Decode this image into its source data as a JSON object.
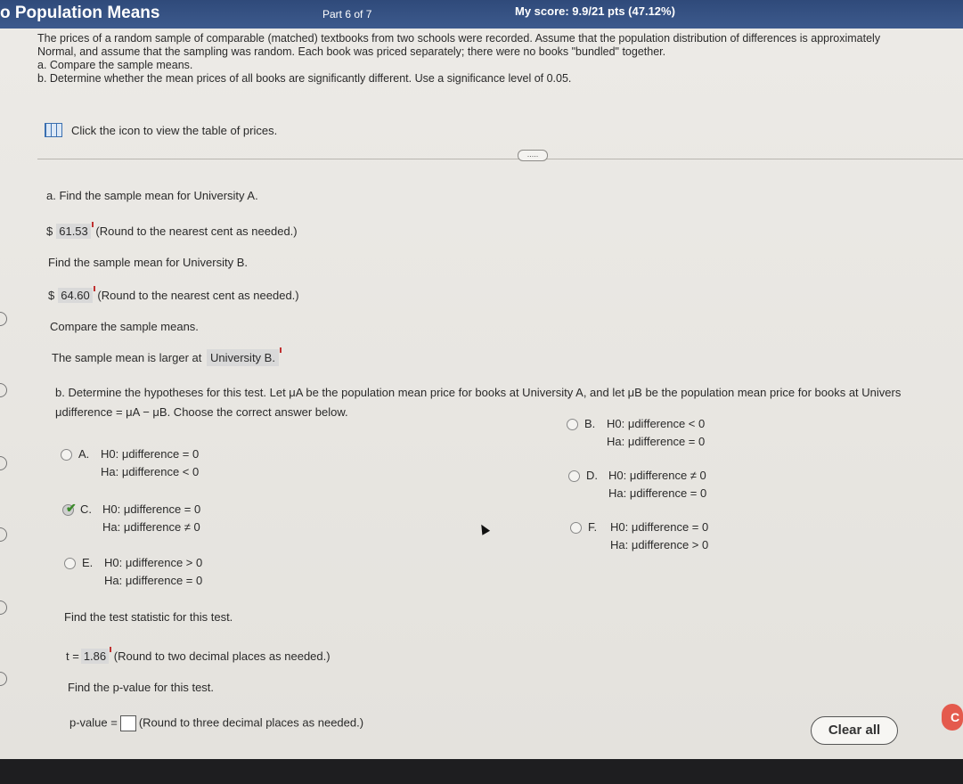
{
  "header": {
    "title": "o Population Means",
    "part": "Part 6 of 7",
    "score": "My score: 9.9/21 pts (47.12%)"
  },
  "intro": {
    "text": "The prices of a random sample of comparable (matched) textbooks from two schools were recorded. Assume that the population distribution of differences is approximately Normal, and assume that the sampling was random. Each book was priced separately; there were no books \"bundled\" together.",
    "a": "a. Compare the sample means.",
    "b": "b. Determine whether the mean prices of all books are significantly different. Use a significance level of 0.05.",
    "table_link": "Click the icon to view the table of prices."
  },
  "part_a": {
    "q1": "a. Find the sample mean for University A.",
    "a1_prefix": "$",
    "a1_value": "61.53",
    "a1_hint": "(Round to the nearest cent as needed.)",
    "q2": "Find the sample mean for University B.",
    "a2_prefix": "$",
    "a2_value": "64.60",
    "a2_hint": "(Round to the nearest cent as needed.)",
    "q3": "Compare the sample means.",
    "a3_prefix": "The sample mean is larger at",
    "a3_value": "University B."
  },
  "part_b": {
    "q1_line1": "b. Determine the hypotheses for this test. Let μA be the population mean price for books at University A, and let μB be the population mean price for books at Univers",
    "q1_line2": "μdifference = μA − μB. Choose the correct answer below.",
    "options": [
      {
        "letter": "A.",
        "h0": "H0: μdifference = 0",
        "ha": "Ha: μdifference < 0"
      },
      {
        "letter": "B.",
        "h0": "H0: μdifference < 0",
        "ha": "Ha: μdifference = 0"
      },
      {
        "letter": "C.",
        "h0": "H0: μdifference = 0",
        "ha": "Ha: μdifference ≠ 0"
      },
      {
        "letter": "D.",
        "h0": "H0: μdifference ≠ 0",
        "ha": "Ha: μdifference = 0"
      },
      {
        "letter": "E.",
        "h0": "H0: μdifference > 0",
        "ha": "Ha: μdifference = 0"
      },
      {
        "letter": "F.",
        "h0": "H0: μdifference = 0",
        "ha": "Ha: μdifference > 0"
      }
    ],
    "selected_option": "C.",
    "q2": "Find the test statistic for this test.",
    "t_prefix": "t =",
    "t_value": "1.86",
    "t_hint": "(Round to two decimal places as needed.)",
    "q3": "Find the p-value for this test.",
    "p_prefix": "p-value =",
    "p_hint": "(Round to three decimal places as needed.)"
  },
  "buttons": {
    "clear_all": "Clear all",
    "next_partial": "C",
    "more": "....."
  }
}
